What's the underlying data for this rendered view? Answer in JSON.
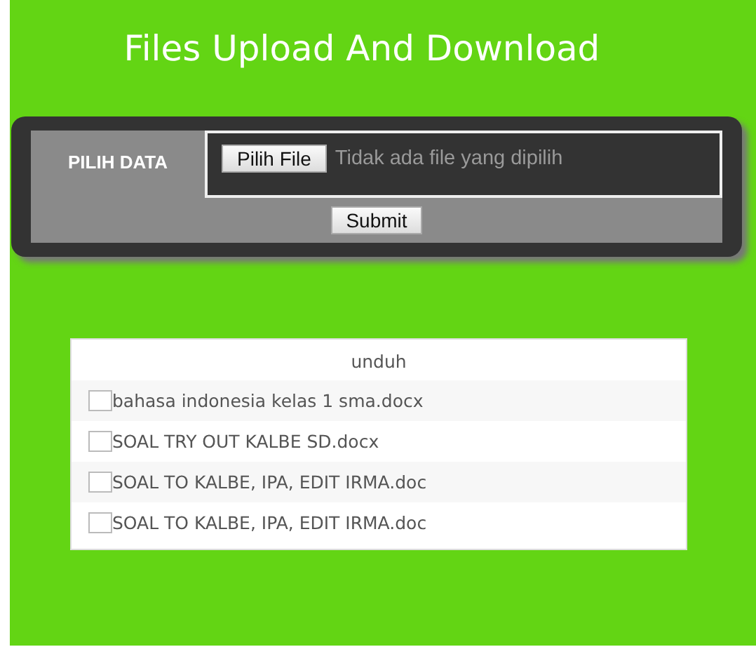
{
  "title": "Files Upload And Download",
  "form": {
    "label": "PILIH DATA",
    "file_button": "Pilih File",
    "file_status": "Tidak ada file yang dipilih",
    "submit": "Submit"
  },
  "table": {
    "header": "unduh",
    "rows": [
      {
        "name": "bahasa indonesia kelas 1 sma.docx",
        "checked": false
      },
      {
        "name": "SOAL TRY OUT KALBE SD.docx",
        "checked": false
      },
      {
        "name": "SOAL TO KALBE, IPA, EDIT IRMA.doc",
        "checked": false
      },
      {
        "name": "SOAL TO KALBE, IPA, EDIT IRMA.doc",
        "checked": false
      }
    ]
  }
}
